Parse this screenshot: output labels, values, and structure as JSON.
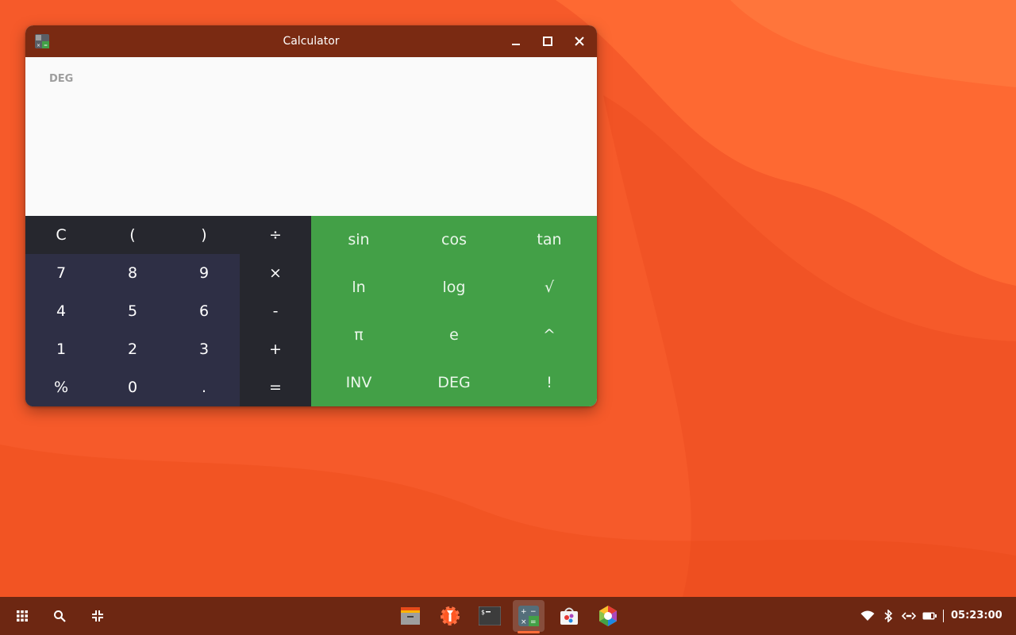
{
  "window": {
    "title": "Calculator"
  },
  "display": {
    "mode": "DEG"
  },
  "basic_keys": [
    [
      "C",
      "(",
      ")",
      "÷"
    ],
    [
      "7",
      "8",
      "9",
      "×"
    ],
    [
      "4",
      "5",
      "6",
      "-"
    ],
    [
      "1",
      "2",
      "3",
      "+"
    ],
    [
      "%",
      "0",
      ".",
      "="
    ]
  ],
  "sci_keys": [
    [
      "sin",
      "cos",
      "tan"
    ],
    [
      "ln",
      "log",
      "√"
    ],
    [
      "π",
      "e",
      "^"
    ],
    [
      "INV",
      "DEG",
      "!"
    ]
  ],
  "taskbar": {
    "apps": [
      "files-icon",
      "settings-icon",
      "terminal-icon",
      "calculator-icon",
      "store-icon",
      "chromium-icon"
    ],
    "active_app": "calculator-icon",
    "clock": "05:23:00"
  },
  "colors": {
    "accent": "#43a047",
    "titlebar": "#7a2a12",
    "taskbar": "#6d2712",
    "wallpaper": "#f4582a"
  }
}
